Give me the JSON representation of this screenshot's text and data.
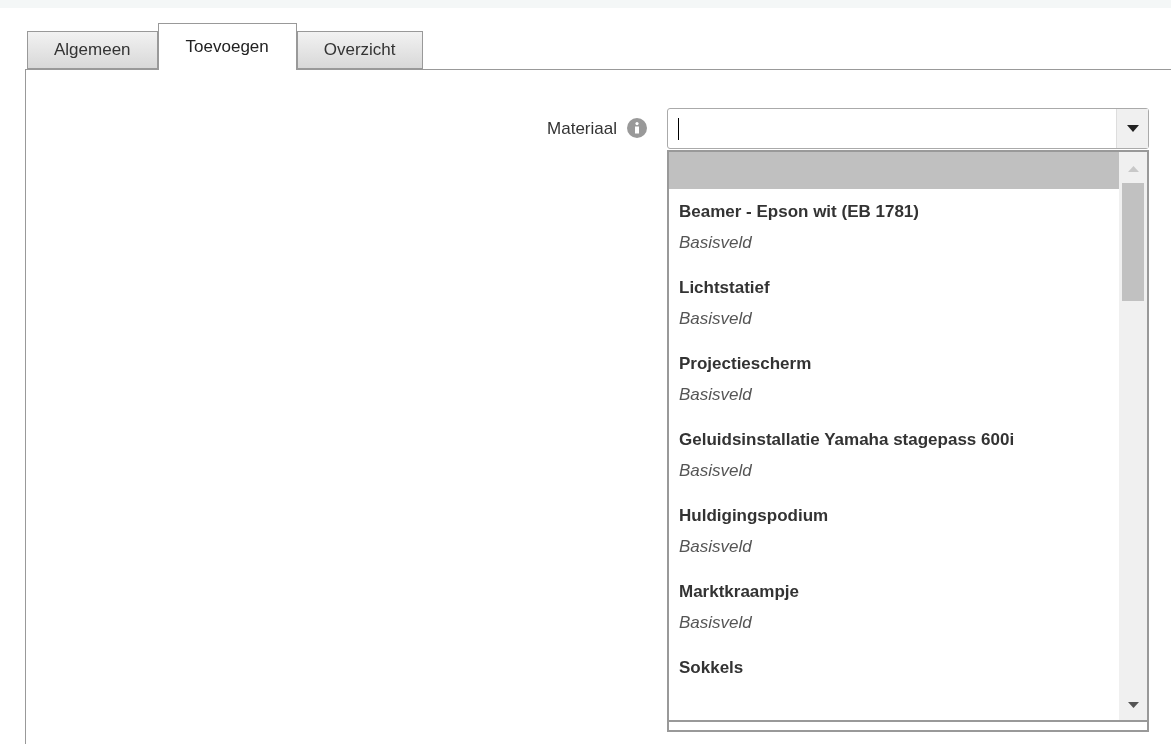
{
  "tabs": [
    {
      "label": "Algemeen",
      "selected": false
    },
    {
      "label": "Toevoegen",
      "selected": true
    },
    {
      "label": "Overzicht",
      "selected": false
    }
  ],
  "field": {
    "label": "Materiaal"
  },
  "options": [
    {
      "selected": true
    },
    {
      "title": "Beamer - Epson wit (EB 1781)",
      "subtitle": "Basisveld",
      "selected": false
    },
    {
      "title": "Lichtstatief",
      "subtitle": "Basisveld",
      "selected": false
    },
    {
      "title": "Projectiescherm",
      "subtitle": "Basisveld",
      "selected": false
    },
    {
      "title": "Geluidsinstallatie Yamaha stagepass 600i",
      "subtitle": "Basisveld",
      "selected": false
    },
    {
      "title": "Huldigingspodium",
      "subtitle": "Basisveld",
      "selected": false
    },
    {
      "title": "Marktkraampje",
      "subtitle": "Basisveld",
      "selected": false
    },
    {
      "title": "Sokkels",
      "selected": false
    }
  ]
}
